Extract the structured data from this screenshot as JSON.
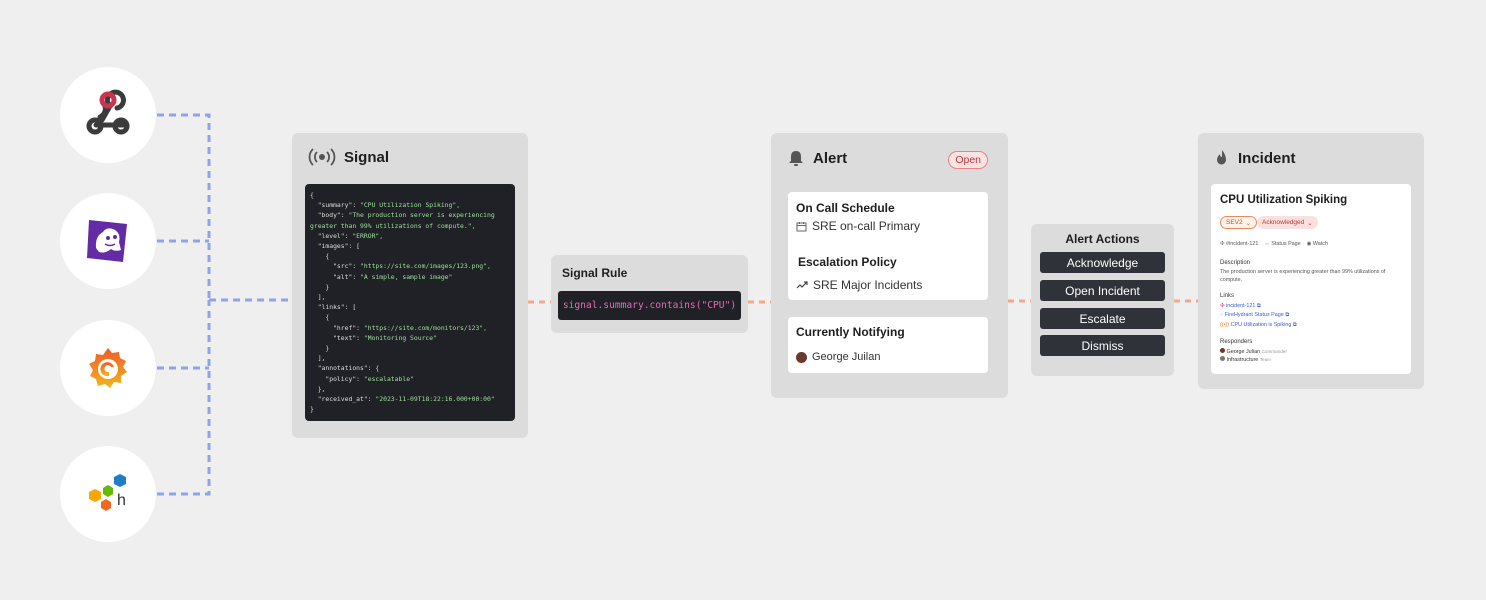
{
  "sources": [
    {
      "name": "webhook-icon"
    },
    {
      "name": "datadog-icon"
    },
    {
      "name": "grafana-icon"
    },
    {
      "name": "honeycomb-icon"
    }
  ],
  "colors": {
    "background": "#efefef",
    "panel": "#dcdcdc",
    "source_connector": "#8ea3ea",
    "flow_connector": "#f2a98a",
    "code_bg": "#1f2126",
    "code_string": "#9ee29a",
    "rule_code": "#e56ab5",
    "open_badge": "#e98383"
  },
  "signal": {
    "title": "Signal",
    "code_lines": [
      {
        "p": "{",
        "s": ""
      },
      {
        "p": "  \"summary\": ",
        "s": "\"CPU Utilization Spiking\","
      },
      {
        "p": "  \"body\": ",
        "s": "\"The production server is experiencing"
      },
      {
        "p": "",
        "s": "greater than 99% utilizations of compute.\","
      },
      {
        "p": "  \"level\": ",
        "s": "\"ERROR\","
      },
      {
        "p": "  \"images\": [",
        "s": ""
      },
      {
        "p": "    {",
        "s": ""
      },
      {
        "p": "      \"src\": ",
        "s": "\"https://site.com/images/123.png\","
      },
      {
        "p": "      \"alt\": ",
        "s": "\"A simple, sample image\""
      },
      {
        "p": "    }",
        "s": ""
      },
      {
        "p": "  ],",
        "s": ""
      },
      {
        "p": "  \"links\": [",
        "s": ""
      },
      {
        "p": "    {",
        "s": ""
      },
      {
        "p": "      \"href\": ",
        "s": "\"https://site.com/monitors/123\","
      },
      {
        "p": "      \"text\": ",
        "s": "\"Monitoring Source\""
      },
      {
        "p": "    }",
        "s": ""
      },
      {
        "p": "  ],",
        "s": ""
      },
      {
        "p": "  \"annotations\": {",
        "s": ""
      },
      {
        "p": "    \"policy\": ",
        "s": "\"escalatable\""
      },
      {
        "p": "  },",
        "s": ""
      },
      {
        "p": "  \"received_at\": ",
        "s": "\"2023-11-09T18:22:16.000+00:00\""
      },
      {
        "p": "}",
        "s": ""
      }
    ]
  },
  "signal_rule": {
    "title": "Signal Rule",
    "expression": "signal.summary.contains(\"CPU\")"
  },
  "alert": {
    "title": "Alert",
    "status": "Open",
    "on_call_heading": "On Call Schedule",
    "on_call_value": "SRE on-call Primary",
    "escalation_heading": "Escalation Policy",
    "escalation_value": "SRE Major Incidents",
    "notifying_heading": "Currently Notifying",
    "notifying_value": "George Juilan"
  },
  "alert_actions": {
    "title": "Alert Actions",
    "buttons": [
      "Acknowledge",
      "Open Incident",
      "Escalate",
      "Dismiss"
    ]
  },
  "incident": {
    "title": "Incident",
    "name": "CPU Utilization Spiking",
    "severity": "SEV2",
    "status": "Acknowledged",
    "channel": "#incident-121",
    "status_page": "Status Page",
    "watch": "Watch",
    "description_label": "Description",
    "description": "The production server is experiencing greater than 99% utilizations of compute.",
    "links_label": "Links",
    "links": [
      "incident-121",
      "FireHydrant Status Page",
      "CPU Utilization is Spiking"
    ],
    "responders_label": "Responders",
    "responders": [
      {
        "name": "George Julian",
        "role": "Commander"
      },
      {
        "name": "Infrastructure",
        "role": "Team"
      }
    ]
  }
}
